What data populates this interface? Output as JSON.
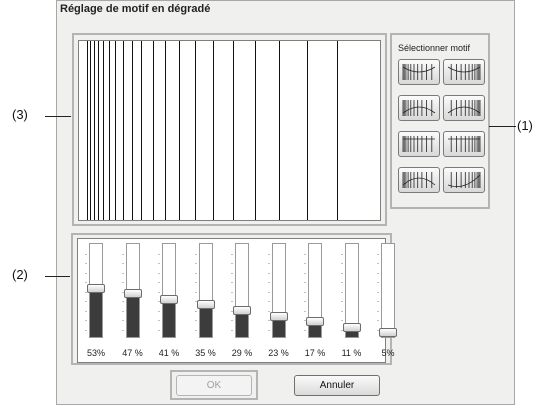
{
  "dialog": {
    "title": "Réglage de motif en dégradé",
    "motif_section_title": "Sélectionner motif",
    "ok_label": "OK",
    "cancel_label": "Annuler"
  },
  "motif_buttons": [
    {
      "name": "motif-1"
    },
    {
      "name": "motif-2"
    },
    {
      "name": "motif-3"
    },
    {
      "name": "motif-4"
    },
    {
      "name": "motif-5"
    },
    {
      "name": "motif-6"
    },
    {
      "name": "motif-7"
    },
    {
      "name": "motif-8"
    }
  ],
  "gradient_levels": [
    {
      "label": "53%",
      "value": 0.53
    },
    {
      "label": "47 %",
      "value": 0.47
    },
    {
      "label": "41 %",
      "value": 0.41
    },
    {
      "label": "35 %",
      "value": 0.35
    },
    {
      "label": "29 %",
      "value": 0.29
    },
    {
      "label": "23 %",
      "value": 0.23
    },
    {
      "label": "17 %",
      "value": 0.17
    },
    {
      "label": "11 %",
      "value": 0.11
    },
    {
      "label": "5%",
      "value": 0.05
    }
  ],
  "callouts": {
    "c1": "(1)",
    "c2": "(2)",
    "c3": "(3)"
  },
  "colors": {
    "fill": "#3c3c3c",
    "frame": "#b4b4b4"
  }
}
